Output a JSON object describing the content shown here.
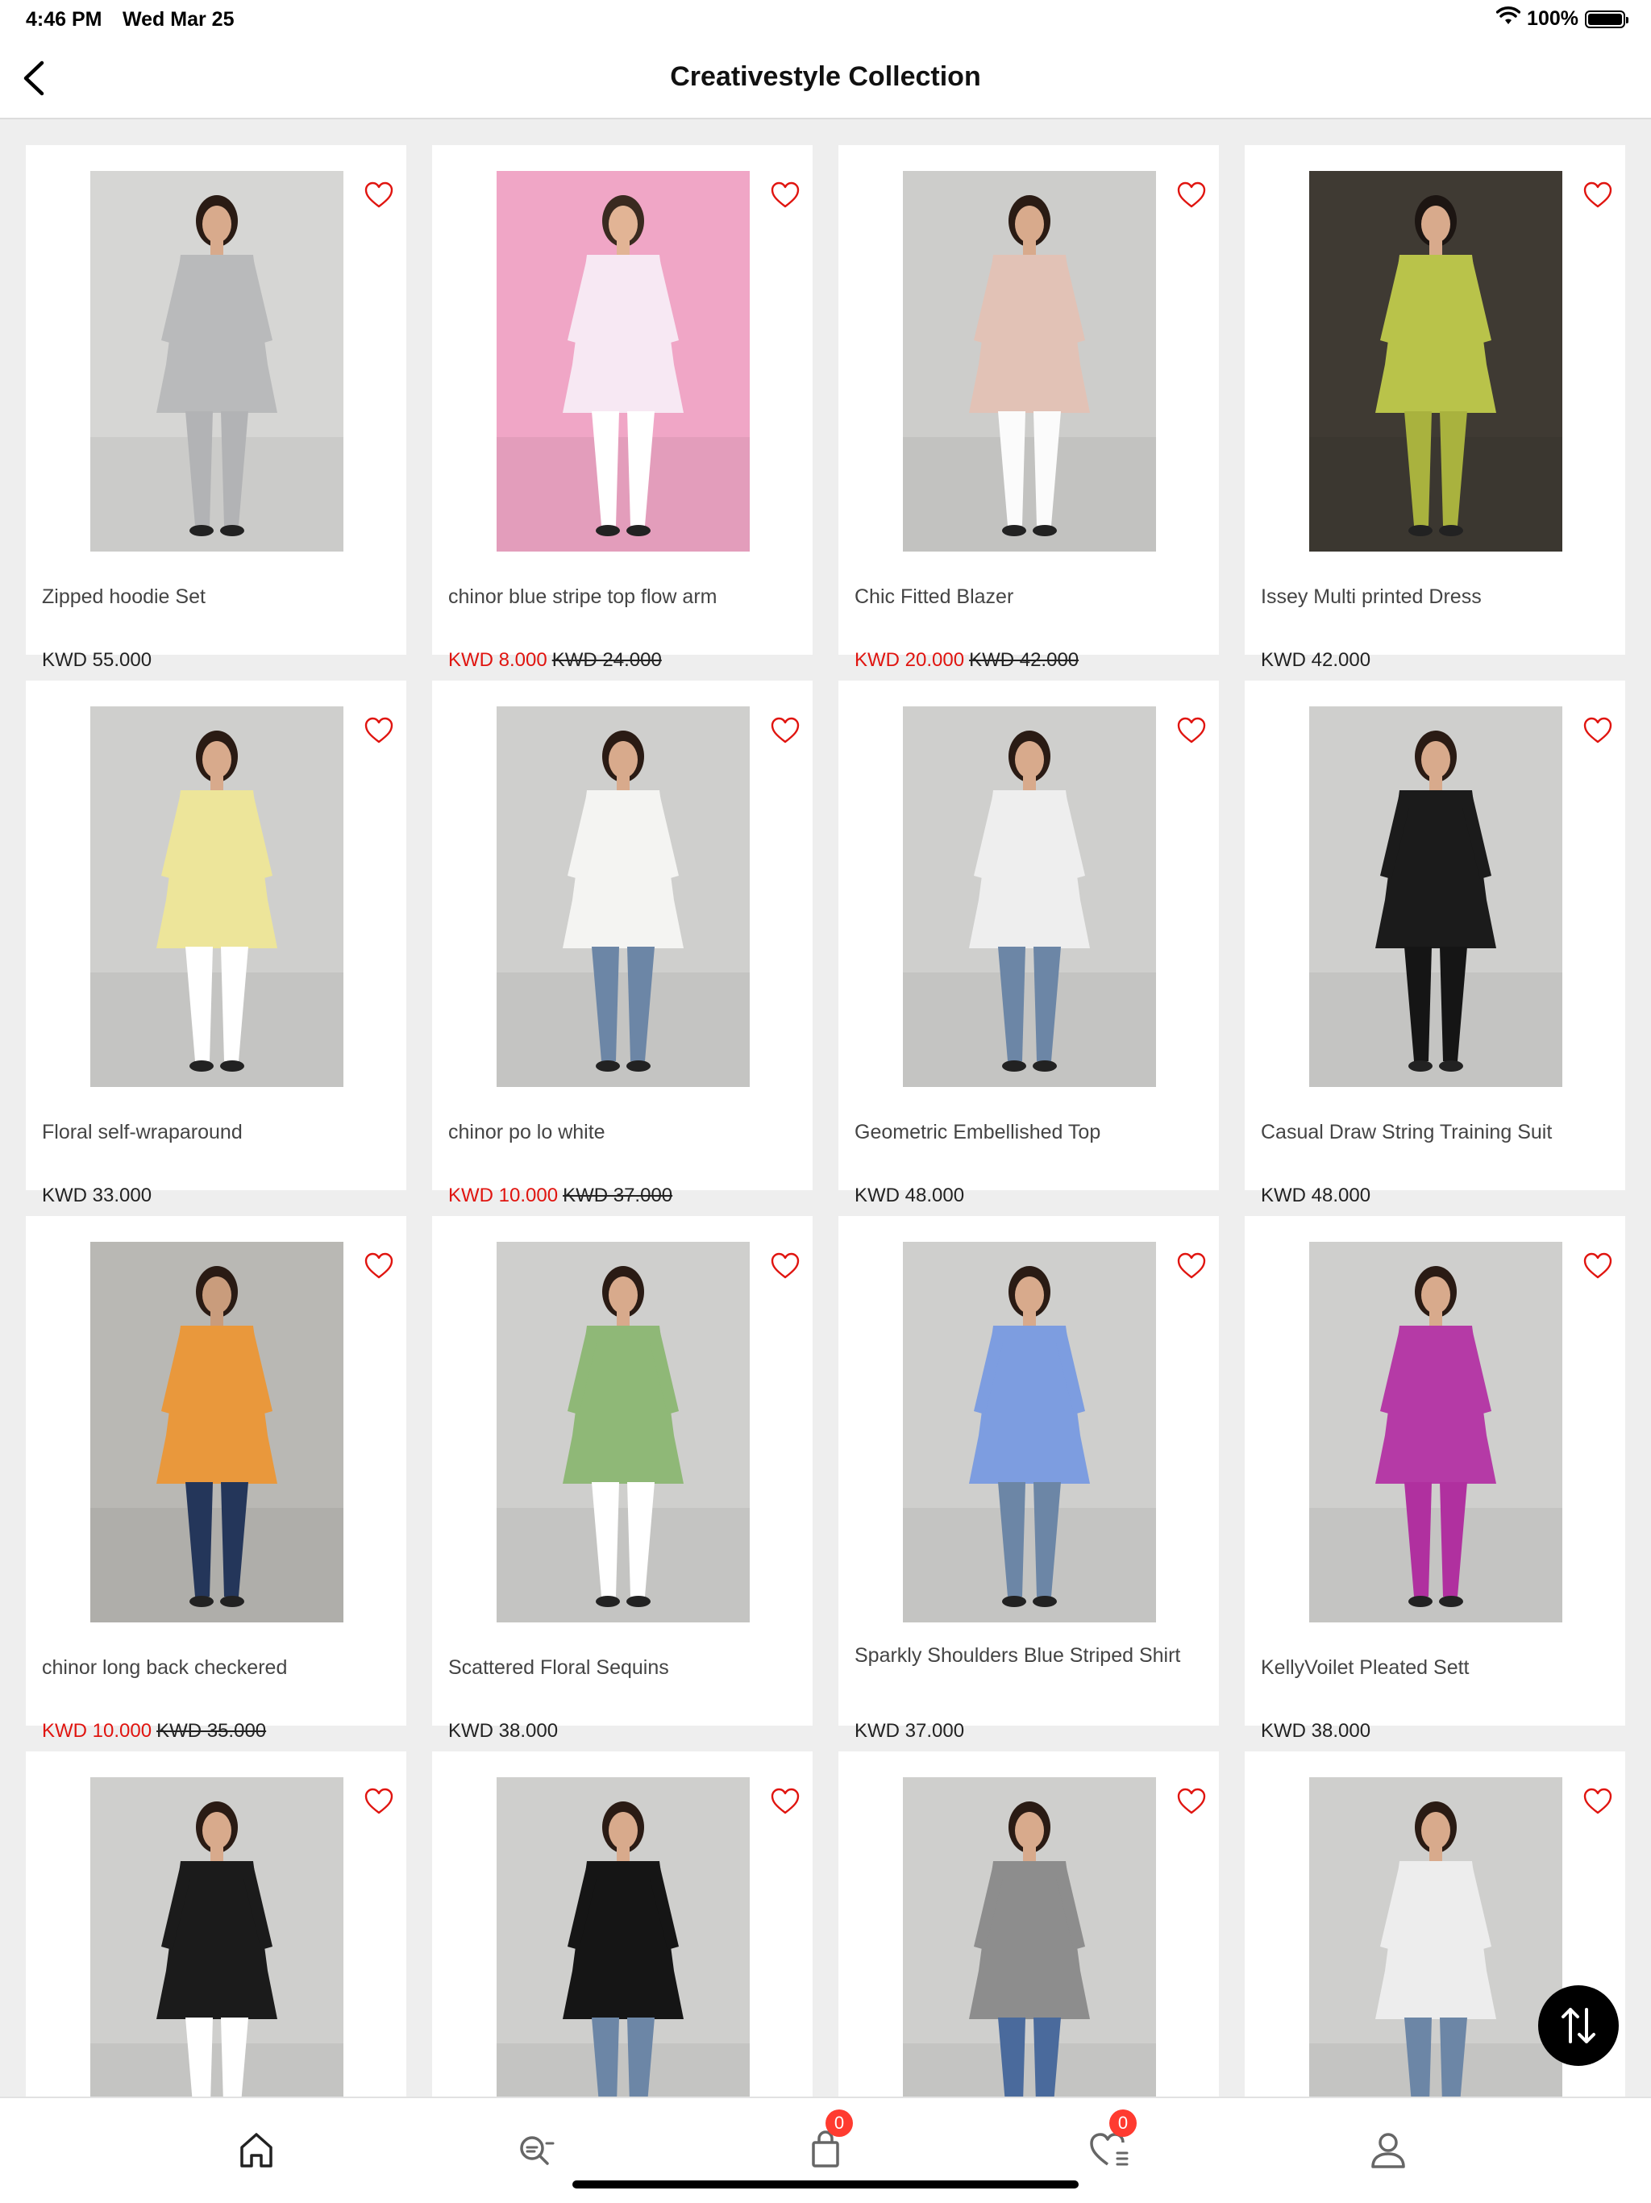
{
  "status_bar": {
    "time": "4:46 PM",
    "date": "Wed Mar 25",
    "battery": "100%"
  },
  "header": {
    "title": "Creativestyle Collection"
  },
  "colors": {
    "sale": "#e0140f",
    "badge": "#ff3b30",
    "heart": "#e0140f"
  },
  "products": [
    {
      "name": "Zipped hoodie Set",
      "price": "KWD 55.000",
      "sale_price": "",
      "old_price": "",
      "bg": "#d6d6d4",
      "top": "#b9babb",
      "bottom": "#b2b3b5",
      "skin": "#d8aa8c",
      "hair": "#2a1b14"
    },
    {
      "name": "chinor blue stripe top flow arm",
      "price": "",
      "sale_price": "KWD 8.000",
      "old_price": "KWD 24.000",
      "bg": "#f0a6c6",
      "top": "#f7e8f3",
      "bottom": "#ffffff",
      "skin": "#e2b495",
      "hair": "#3a2a20"
    },
    {
      "name": "Chic Fitted Blazer",
      "price": "",
      "sale_price": "KWD 20.000",
      "old_price": "KWD 42.000",
      "bg": "#cdcdcb",
      "top": "#e2c2b6",
      "bottom": "#fbfbfb",
      "skin": "#d8aa8c",
      "hair": "#2a1b14"
    },
    {
      "name": "Issey Multi printed Dress",
      "price": "KWD 42.000",
      "sale_price": "",
      "old_price": "",
      "bg": "#3f3a33",
      "top": "#b9c34a",
      "bottom": "#a9b23e",
      "skin": "#d8aa8c",
      "hair": "#1c1512"
    },
    {
      "name": "Floral self-wraparound",
      "price": "KWD 33.000",
      "sale_price": "",
      "old_price": "",
      "bg": "#cfcfcd",
      "top": "#ede59a",
      "bottom": "#ffffff",
      "skin": "#d8aa8c",
      "hair": "#2a1b14"
    },
    {
      "name": "chinor po lo white",
      "price": "",
      "sale_price": "KWD 10.000",
      "old_price": "KWD 37.000",
      "bg": "#cfcfcd",
      "top": "#f4f4f2",
      "bottom": "#6c86a6",
      "skin": "#d8aa8c",
      "hair": "#2a1b14"
    },
    {
      "name": "Geometric Embellished Top",
      "price": "KWD 48.000",
      "sale_price": "",
      "old_price": "",
      "bg": "#cfcfcd",
      "top": "#eeeeee",
      "bottom": "#6c86a6",
      "skin": "#d8aa8c",
      "hair": "#2a1b14"
    },
    {
      "name": "Casual Draw String Training Suit",
      "price": "KWD 48.000",
      "sale_price": "",
      "old_price": "",
      "bg": "#cfcfcd",
      "top": "#1b1b1b",
      "bottom": "#151515",
      "skin": "#d8aa8c",
      "hair": "#2a1b14"
    },
    {
      "name": "chinor long back checkered",
      "price": "",
      "sale_price": "KWD 10.000",
      "old_price": "KWD 35.000",
      "bg": "#b9b8b4",
      "top": "#e9983c",
      "bottom": "#24365a",
      "skin": "#c99c7c",
      "hair": "#2a1b14"
    },
    {
      "name": "Scattered Floral Sequins",
      "price": "KWD 38.000",
      "sale_price": "",
      "old_price": "",
      "bg": "#cfcfcd",
      "top": "#8fb877",
      "bottom": "#ffffff",
      "skin": "#d8aa8c",
      "hair": "#2a1b14"
    },
    {
      "name": "Sparkly Shoulders Blue Striped Shirt",
      "price": "KWD 37.000",
      "sale_price": "",
      "old_price": "",
      "bg": "#cfcfcd",
      "top": "#7d9de0",
      "bottom": "#6c86a6",
      "skin": "#d8aa8c",
      "hair": "#2a1b14"
    },
    {
      "name": "KellyVoilet Pleated Sett",
      "price": "KWD 38.000",
      "sale_price": "",
      "old_price": "",
      "bg": "#cfcfcd",
      "top": "#b53aa6",
      "bottom": "#b0309f",
      "skin": "#d8aa8c",
      "hair": "#2a1b14"
    },
    {
      "name": "",
      "price": "",
      "sale_price": "",
      "old_price": "",
      "bg": "#cfcfcd",
      "top": "#1b1b1b",
      "bottom": "#ffffff",
      "skin": "#d8aa8c",
      "hair": "#2a1b14"
    },
    {
      "name": "",
      "price": "",
      "sale_price": "",
      "old_price": "",
      "bg": "#cfcfcd",
      "top": "#151515",
      "bottom": "#6c86a6",
      "skin": "#d8aa8c",
      "hair": "#2a1b14"
    },
    {
      "name": "",
      "price": "",
      "sale_price": "",
      "old_price": "",
      "bg": "#cfcfcd",
      "top": "#8d8d8d",
      "bottom": "#4a6a9c",
      "skin": "#d8aa8c",
      "hair": "#2a1b14"
    },
    {
      "name": "",
      "price": "",
      "sale_price": "",
      "old_price": "",
      "bg": "#cfcfcd",
      "top": "#ededed",
      "bottom": "#6c86a6",
      "skin": "#d8aa8c",
      "hair": "#2a1b14"
    }
  ],
  "tab_bar": {
    "items": [
      {
        "icon": "home-icon"
      },
      {
        "icon": "search-icon"
      },
      {
        "icon": "shopping-bag-icon",
        "badge": "0"
      },
      {
        "icon": "wishlist-icon",
        "badge": "0"
      },
      {
        "icon": "profile-icon"
      }
    ]
  }
}
